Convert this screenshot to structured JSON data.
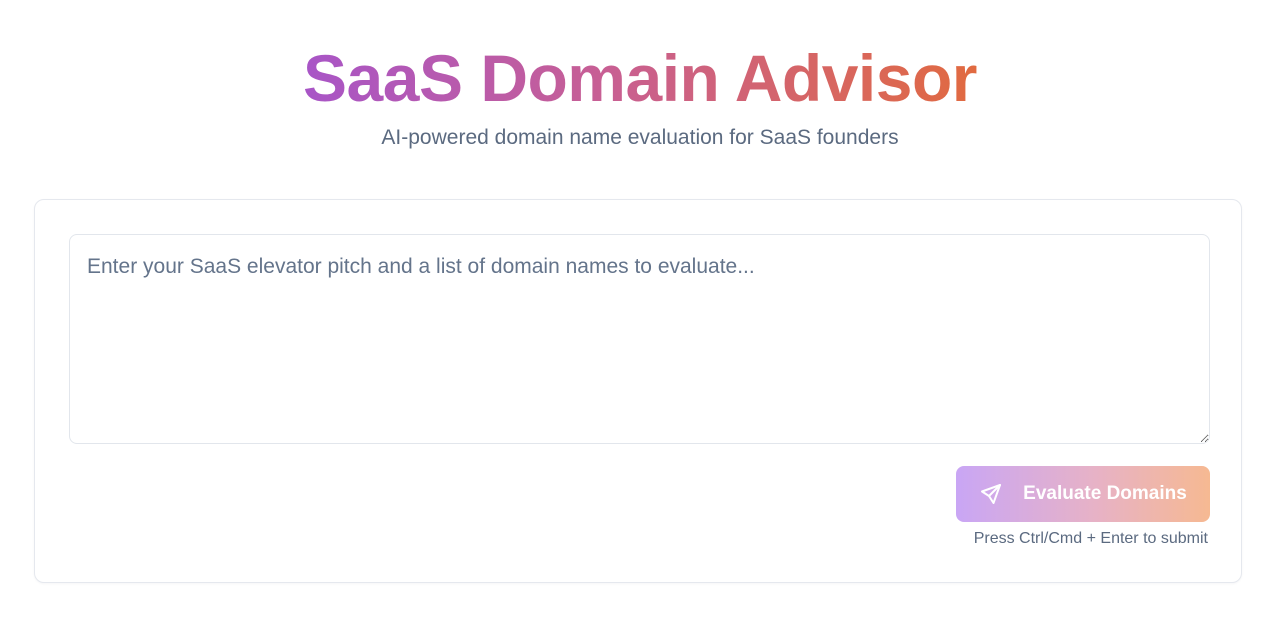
{
  "header": {
    "title": "SaaS Domain Advisor",
    "subtitle": "AI-powered domain name evaluation for SaaS founders"
  },
  "form": {
    "pitch_input": {
      "value": "",
      "placeholder": "Enter your SaaS elevator pitch and a list of domain names to evaluate..."
    },
    "submit_label": "Evaluate Domains",
    "hint": "Press Ctrl/Cmd + Enter to submit"
  },
  "colors": {
    "title_gradient": [
      "#a855c7",
      "#c85f93",
      "#e16a40"
    ],
    "button_gradient": [
      "#c9a6f5",
      "#e7b2c6",
      "#f6b992"
    ],
    "muted_text": "#5b6a80"
  },
  "icons": {
    "submit_icon": "send-icon"
  }
}
